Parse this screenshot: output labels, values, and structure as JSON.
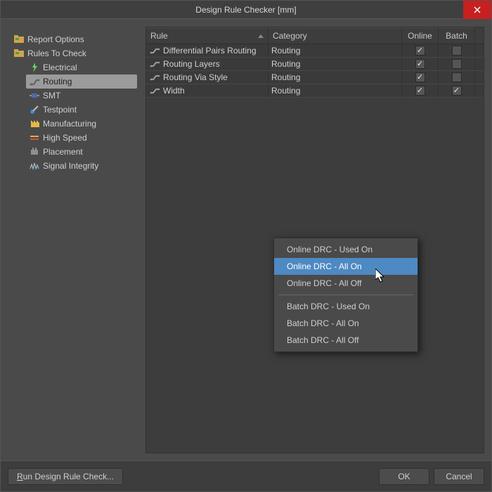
{
  "title": "Design Rule Checker [mm]",
  "tree": {
    "report_options": "Report Options",
    "rules_to_check": "Rules To Check",
    "children": [
      {
        "label": "Electrical"
      },
      {
        "label": "Routing"
      },
      {
        "label": "SMT"
      },
      {
        "label": "Testpoint"
      },
      {
        "label": "Manufacturing"
      },
      {
        "label": "High Speed"
      },
      {
        "label": "Placement"
      },
      {
        "label": "Signal Integrity"
      }
    ]
  },
  "grid": {
    "headers": {
      "rule": "Rule",
      "category": "Category",
      "online": "Online",
      "batch": "Batch"
    },
    "rows": [
      {
        "rule": "Differential Pairs Routing",
        "category": "Routing",
        "online": true,
        "batch": false
      },
      {
        "rule": "Routing Layers",
        "category": "Routing",
        "online": true,
        "batch": false
      },
      {
        "rule": "Routing Via Style",
        "category": "Routing",
        "online": true,
        "batch": false
      },
      {
        "rule": "Width",
        "category": "Routing",
        "online": true,
        "batch": true
      }
    ]
  },
  "context_menu": {
    "items": [
      {
        "label": "Online DRC - Used On",
        "hi": false
      },
      {
        "label": "Online DRC - All On",
        "hi": true
      },
      {
        "label": "Online DRC - All Off",
        "hi": false
      },
      {
        "sep": true
      },
      {
        "label": "Batch DRC - Used On",
        "hi": false
      },
      {
        "label": "Batch DRC - All On",
        "hi": false
      },
      {
        "label": "Batch DRC - All Off",
        "hi": false
      }
    ]
  },
  "buttons": {
    "run": {
      "pre": "R",
      "rest": "un Design Rule Check..."
    },
    "ok": "OK",
    "cancel": "Cancel"
  }
}
